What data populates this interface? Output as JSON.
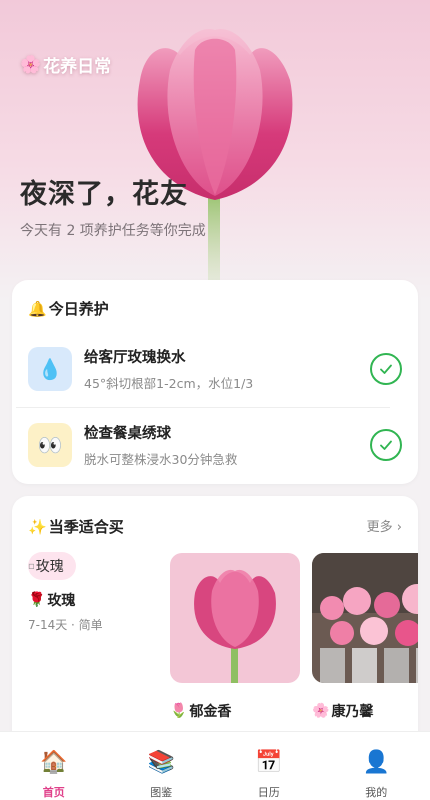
{
  "app": {
    "brand_emoji": "🌸",
    "brand": "花养日常"
  },
  "hero": {
    "greeting": "夜深了，花友",
    "subtitle": "今天有 2 项养护任务等你完成"
  },
  "care": {
    "title_emoji": "🔔",
    "title": "今日养护",
    "tasks": [
      {
        "icon": "💧",
        "icon_name": "water-drop-icon",
        "name": "给客厅玫瑰换水",
        "desc": "45°斜切根部1-2cm，水位1/3",
        "done": true
      },
      {
        "icon": "👀",
        "icon_name": "eyes-icon",
        "name": "检查餐桌绣球",
        "desc": "脱水可整株浸水30分钟急救",
        "done": true
      }
    ]
  },
  "season": {
    "title_emoji": "✨",
    "title": "当季适合买",
    "more": "更多 ›",
    "items": [
      {
        "img_alt": "玫瑰",
        "emoji": "🌹",
        "name": "玫瑰",
        "meta": "7-14天 · 简单"
      },
      {
        "emoji": "🌷",
        "name": "郁金香"
      },
      {
        "emoji": "🌸",
        "name": "康乃馨"
      }
    ]
  },
  "tabbar": {
    "items": [
      {
        "icon": "🏠",
        "label": "首页",
        "active": true
      },
      {
        "icon": "📚",
        "label": "图鉴",
        "active": false
      },
      {
        "icon": "📅",
        "label": "日历",
        "active": false
      },
      {
        "icon": "👤",
        "label": "我的",
        "active": false
      }
    ]
  },
  "colors": {
    "accent": "#e0408a",
    "check": "#31b552"
  }
}
